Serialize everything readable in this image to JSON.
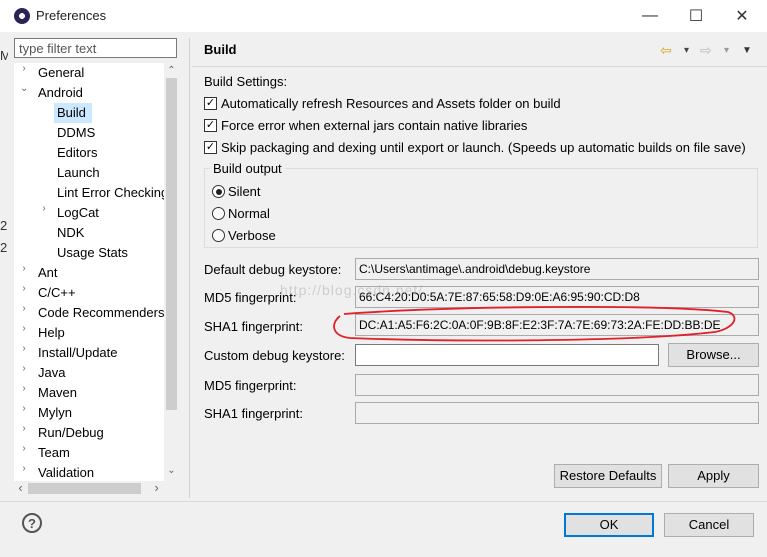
{
  "window": {
    "title": "Preferences",
    "minimize_glyph": "—",
    "maximize_glyph": "☐",
    "close_glyph": "✕"
  },
  "filter": {
    "placeholder": "type filter text",
    "value": ""
  },
  "tree": {
    "items": [
      {
        "label": "General",
        "arrow": "›"
      },
      {
        "label": "Android",
        "arrow": "⌄"
      },
      {
        "label": "Build",
        "arrow": ""
      },
      {
        "label": "DDMS",
        "arrow": ""
      },
      {
        "label": "Editors",
        "arrow": ""
      },
      {
        "label": "Launch",
        "arrow": ""
      },
      {
        "label": "Lint Error Checking",
        "arrow": ""
      },
      {
        "label": "LogCat",
        "arrow": "›"
      },
      {
        "label": "NDK",
        "arrow": ""
      },
      {
        "label": "Usage Stats",
        "arrow": ""
      },
      {
        "label": "Ant",
        "arrow": "›"
      },
      {
        "label": "C/C++",
        "arrow": "›"
      },
      {
        "label": "Code Recommenders",
        "arrow": "›"
      },
      {
        "label": "Help",
        "arrow": "›"
      },
      {
        "label": "Install/Update",
        "arrow": "›"
      },
      {
        "label": "Java",
        "arrow": "›"
      },
      {
        "label": "Maven",
        "arrow": "›"
      },
      {
        "label": "Mylyn",
        "arrow": "›"
      },
      {
        "label": "Run/Debug",
        "arrow": "›"
      },
      {
        "label": "Team",
        "arrow": "›"
      },
      {
        "label": "Validation",
        "arrow": "›"
      }
    ],
    "scroll_up": "⌃",
    "scroll_down": "⌄",
    "scroll_left": "‹",
    "scroll_right": "›"
  },
  "page": {
    "title": "Build",
    "back_glyph": "⇦",
    "forward_glyph": "⇨",
    "dropdown_glyph": "▾",
    "menu_glyph": "▼",
    "build_settings_label": "Build Settings:",
    "checkboxes": [
      {
        "label": "Automatically refresh Resources and Assets folder on build",
        "checked": "✓"
      },
      {
        "label": "Force error when external jars contain native libraries",
        "checked": "✓"
      },
      {
        "label": "Skip packaging and dexing until export or launch. (Speeds up automatic builds on file save)",
        "checked": "✓"
      }
    ],
    "build_output": {
      "legend": "Build output",
      "options": [
        "Silent",
        "Normal",
        "Verbose"
      ],
      "selected": "Silent"
    },
    "default_keystore_label": "Default debug keystore:",
    "default_keystore_value": "C:\\Users\\antimage\\.android\\debug.keystore",
    "md5_label": "MD5 fingerprint:",
    "md5_value": "66:C4:20:D0:5A:7E:87:65:58:D9:0E:A6:95:90:CD:D8",
    "sha1_label": "SHA1 fingerprint:",
    "sha1_value": "DC:A1:A5:F6:2C:0A:0F:9B:8F:E2:3F:7A:7E:69:73:2A:FE:DD:BB:DE",
    "custom_keystore_label": "Custom debug keystore:",
    "custom_keystore_value": "",
    "browse_label": "Browse...",
    "custom_md5_label": "MD5 fingerprint:",
    "custom_md5_value": "",
    "custom_sha1_label": "SHA1 fingerprint:",
    "custom_sha1_value": "",
    "restore_defaults_label": "Restore Defaults",
    "apply_label": "Apply",
    "annotation_color": "#e0202a"
  },
  "footer": {
    "help_glyph": "?",
    "ok_label": "OK",
    "cancel_label": "Cancel"
  },
  "watermark": "http://blog.csdn.net/"
}
